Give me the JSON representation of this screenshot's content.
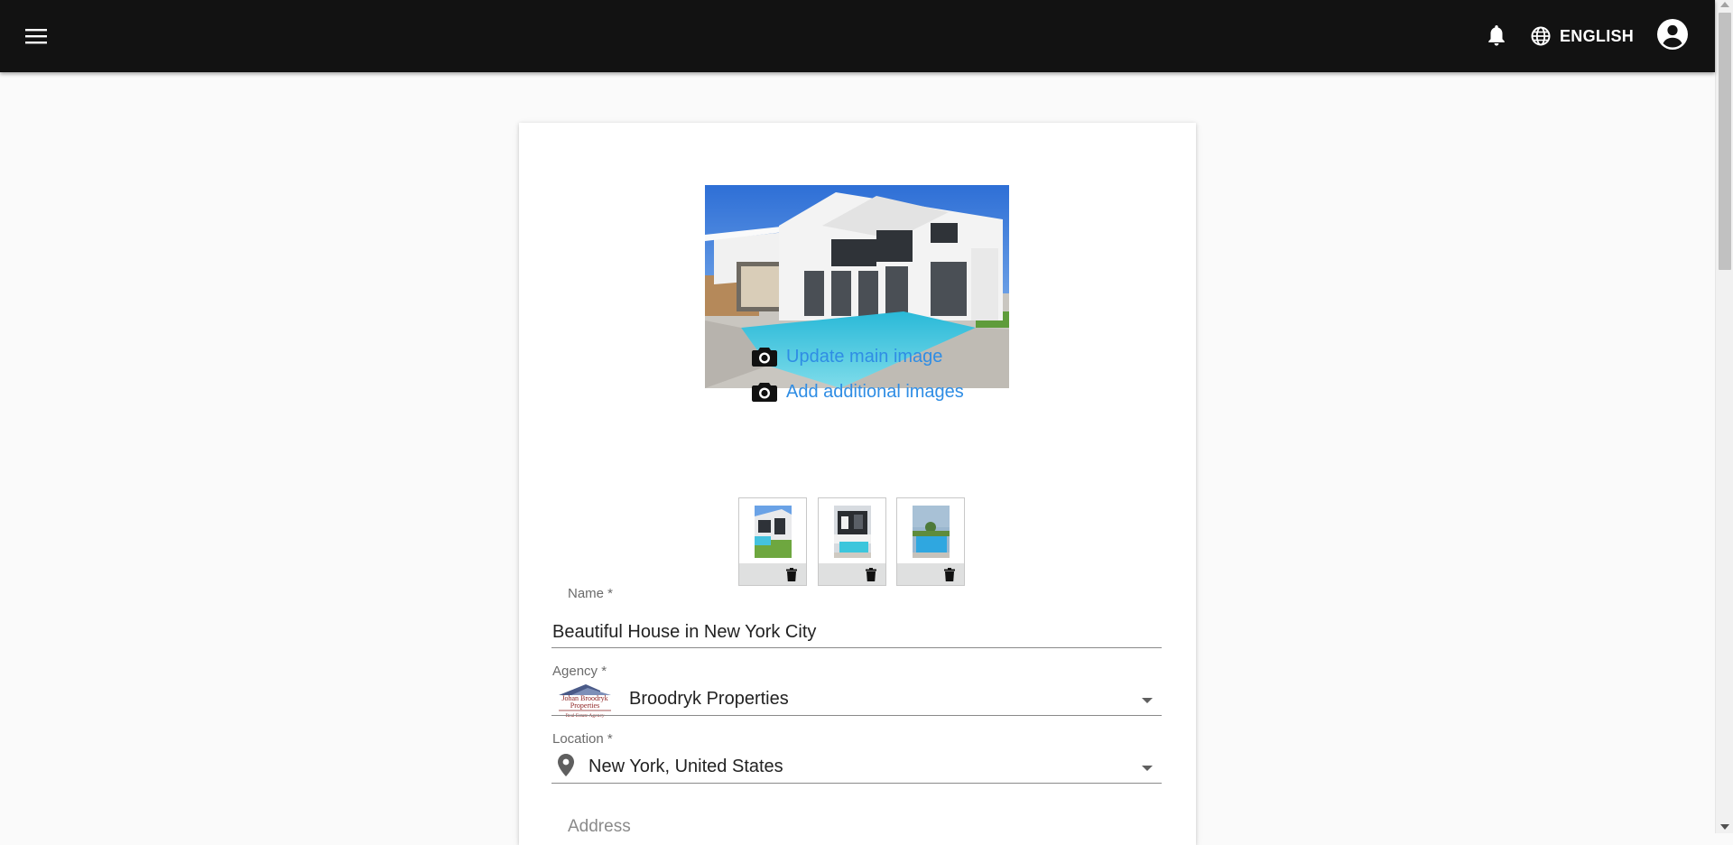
{
  "header": {
    "menu_icon": "hamburger-menu-icon",
    "notification_icon": "bell-icon",
    "language_icon": "globe-icon",
    "language_label": "ENGLISH",
    "account_icon": "account-circle-icon",
    "background": "#121212"
  },
  "image_panel": {
    "main_image": "modern white two-story house with pool",
    "update_main_label": "Update main image",
    "add_additional_label": "Add additional images",
    "camera_icon": "camera-icon",
    "link_color": "#2f8de4",
    "thumbnails": [
      {
        "description": "house with lawn and pool",
        "delete_icon": "trash-icon"
      },
      {
        "description": "dark house with pool",
        "delete_icon": "trash-icon"
      },
      {
        "description": "pool with blue sky",
        "delete_icon": "trash-icon"
      }
    ]
  },
  "form": {
    "name": {
      "label": "Name *",
      "value": "Beautiful House in New York City"
    },
    "agency": {
      "label": "Agency *",
      "value": "Broodryk Properties",
      "logo_text": [
        "Johan Broodryk",
        "Properties",
        "Real Estate Agency"
      ]
    },
    "location": {
      "label": "Location *",
      "value": "New York, United States",
      "icon": "location-pin-icon"
    },
    "address": {
      "label": "Address"
    }
  }
}
